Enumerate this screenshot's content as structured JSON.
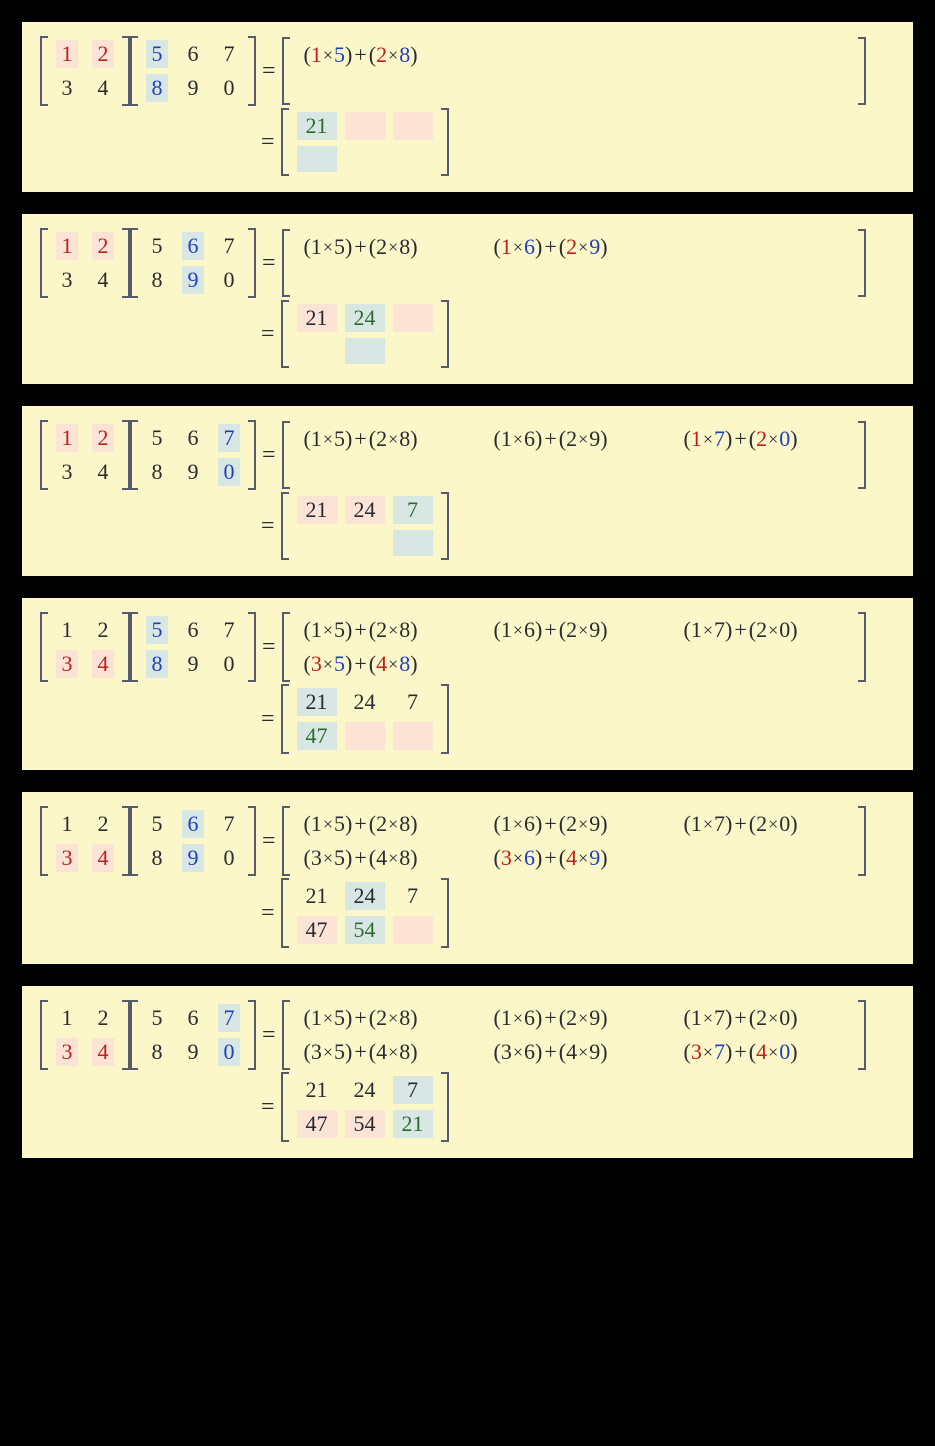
{
  "matrixA": [
    [
      "1",
      "2"
    ],
    [
      "3",
      "4"
    ]
  ],
  "matrixB": [
    [
      "5",
      "6",
      "7"
    ],
    [
      "8",
      "9",
      "0"
    ]
  ],
  "result": [
    [
      "21",
      "24",
      "7"
    ],
    [
      "47",
      "54",
      "21"
    ]
  ],
  "terms": {
    "r1c1": {
      "a1": "1",
      "b1": "5",
      "a2": "2",
      "b2": "8"
    },
    "r1c2": {
      "a1": "1",
      "b1": "6",
      "a2": "2",
      "b2": "9"
    },
    "r1c3": {
      "a1": "1",
      "b1": "7",
      "a2": "2",
      "b2": "0"
    },
    "r2c1": {
      "a1": "3",
      "b1": "5",
      "a2": "4",
      "b2": "8"
    },
    "r2c2": {
      "a1": "3",
      "b1": "6",
      "a2": "4",
      "b2": "9"
    },
    "r2c3": {
      "a1": "3",
      "b1": "7",
      "a2": "4",
      "b2": "0"
    }
  },
  "eq": "=",
  "panels": [
    {
      "A_hl": {
        "row": 0
      },
      "B_hl": {
        "col": 0
      },
      "expand": [
        [
          {
            "k": "r1c1",
            "active": true
          },
          null,
          null
        ],
        [
          null,
          null,
          null
        ]
      ],
      "res_shown": [
        [
          "21",
          null,
          null
        ],
        [
          null,
          null,
          null
        ]
      ],
      "res_hl": {
        "row": 0,
        "col": 0
      }
    },
    {
      "A_hl": {
        "row": 0
      },
      "B_hl": {
        "col": 1
      },
      "expand": [
        [
          {
            "k": "r1c1"
          },
          {
            "k": "r1c2",
            "active": true
          },
          null
        ],
        [
          null,
          null,
          null
        ]
      ],
      "res_shown": [
        [
          "21",
          "24",
          null
        ],
        [
          null,
          null,
          null
        ]
      ],
      "res_hl": {
        "row": 0,
        "col": 1
      }
    },
    {
      "A_hl": {
        "row": 0
      },
      "B_hl": {
        "col": 2
      },
      "expand": [
        [
          {
            "k": "r1c1"
          },
          {
            "k": "r1c2"
          },
          {
            "k": "r1c3",
            "active": true
          }
        ],
        [
          null,
          null,
          null
        ]
      ],
      "res_shown": [
        [
          "21",
          "24",
          "7"
        ],
        [
          null,
          null,
          null
        ]
      ],
      "res_hl": {
        "row": 0,
        "col": 2
      }
    },
    {
      "A_hl": {
        "row": 1
      },
      "B_hl": {
        "col": 0
      },
      "expand": [
        [
          {
            "k": "r1c1"
          },
          {
            "k": "r1c2"
          },
          {
            "k": "r1c3"
          }
        ],
        [
          {
            "k": "r2c1",
            "active": true
          },
          null,
          null
        ]
      ],
      "res_shown": [
        [
          "21",
          "24",
          "7"
        ],
        [
          "47",
          null,
          null
        ]
      ],
      "res_hl": {
        "row": 1,
        "col": 0
      }
    },
    {
      "A_hl": {
        "row": 1
      },
      "B_hl": {
        "col": 1
      },
      "expand": [
        [
          {
            "k": "r1c1"
          },
          {
            "k": "r1c2"
          },
          {
            "k": "r1c3"
          }
        ],
        [
          {
            "k": "r2c1"
          },
          {
            "k": "r2c2",
            "active": true
          },
          null
        ]
      ],
      "res_shown": [
        [
          "21",
          "24",
          "7"
        ],
        [
          "47",
          "54",
          null
        ]
      ],
      "res_hl": {
        "row": 1,
        "col": 1
      }
    },
    {
      "A_hl": {
        "row": 1
      },
      "B_hl": {
        "col": 2
      },
      "expand": [
        [
          {
            "k": "r1c1"
          },
          {
            "k": "r1c2"
          },
          {
            "k": "r1c3"
          }
        ],
        [
          {
            "k": "r2c1"
          },
          {
            "k": "r2c2"
          },
          {
            "k": "r2c3",
            "active": true
          }
        ]
      ],
      "res_shown": [
        [
          "21",
          "24",
          "7"
        ],
        [
          "47",
          "54",
          "21"
        ]
      ],
      "res_hl": {
        "row": 1,
        "col": 2
      }
    }
  ]
}
